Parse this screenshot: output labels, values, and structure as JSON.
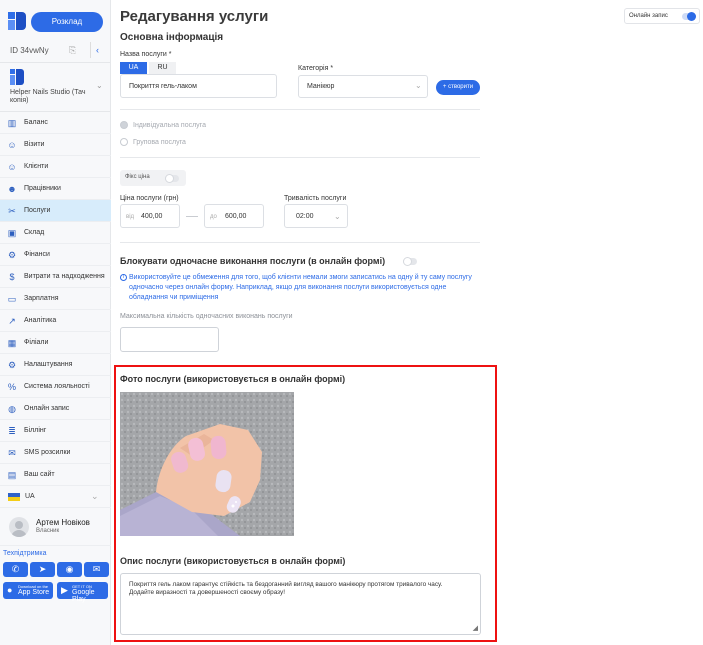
{
  "sidebar": {
    "schedule_label": "Розклад",
    "id_label": "ID 34vwNy",
    "studio_name": "Helper Nails Studio (Тач копія)",
    "nav": [
      {
        "label": "Баланс",
        "icon": "chart-icon"
      },
      {
        "label": "Візити",
        "icon": "user-icon"
      },
      {
        "label": "Клієнти",
        "icon": "user-icon"
      },
      {
        "label": "Працівники",
        "icon": "users-icon"
      },
      {
        "label": "Послуги",
        "icon": "scissors-icon",
        "active": true
      },
      {
        "label": "Склад",
        "icon": "box-icon"
      },
      {
        "label": "Фінанси",
        "icon": "finance-icon"
      },
      {
        "label": "Витрати та надходження",
        "icon": "money-icon"
      },
      {
        "label": "Зарплатня",
        "icon": "wallet-icon"
      },
      {
        "label": "Аналітика",
        "icon": "trend-icon"
      },
      {
        "label": "Філіали",
        "icon": "grid-icon"
      },
      {
        "label": "Налаштування",
        "icon": "gear-icon"
      },
      {
        "label": "Система лояльності",
        "icon": "percent-icon"
      },
      {
        "label": "Онлайн запис",
        "icon": "globe-icon"
      },
      {
        "label": "Біллінг",
        "icon": "billing-icon"
      },
      {
        "label": "SMS розсилки",
        "icon": "sms-icon"
      },
      {
        "label": "Ваш сайт",
        "icon": "site-icon"
      }
    ],
    "language": "UA",
    "user_name": "Артем Новіков",
    "user_role": "Власник",
    "support_label": "Техпідтримка",
    "app_store": {
      "small": "Download on the",
      "big": "App Store"
    },
    "google_play": {
      "small": "GET IT ON",
      "big": "Google Play"
    }
  },
  "page": {
    "title": "Редагування услуги",
    "online_booking_label": "Онлайн запис",
    "section_title": "Основна інформація",
    "service_name_label": "Назва послуги *",
    "lang_tabs": [
      "UA",
      "RU"
    ],
    "service_name_value": "Покриття гель-лаком",
    "category_label": "Категорія *",
    "category_value": "Манікюр",
    "create_label": "+ створити",
    "radio_individual": "Індивідуальна послуга",
    "radio_group": "Групова послуга",
    "fixed_price_label": "Фікс ціна",
    "price_label": "Ціна послуги (грн)",
    "price_from_prefix": "від",
    "price_from": "400,00",
    "price_to_prefix": "до",
    "price_to": "600,00",
    "duration_label": "Тривалість послуги",
    "duration_value": "02:00",
    "block_title": "Блокувати одночасне виконання послуги (в онлайн формі)",
    "block_info": "Використовуйте це обмеження для того, щоб клієнти немали змоги записатись на одну й ту саму послугу одночасно через онлайн форму. Наприклад, якщо для виконання послуги використовується одне обладнання чи приміщення",
    "max_label": "Максимальна кількість одночасних виконань послуги",
    "max_value": "",
    "photo_title": "Фото послуги (використовується в онлайн формі)",
    "description_title": "Опис послуги (використовується в онлайн формі)",
    "description_text": "Покриття гель лаком гарантує стійкість та бездоганний вигляд вашого манікюру протягом тривалого часу. Додайте виразності та довершеності своєму образу!"
  }
}
